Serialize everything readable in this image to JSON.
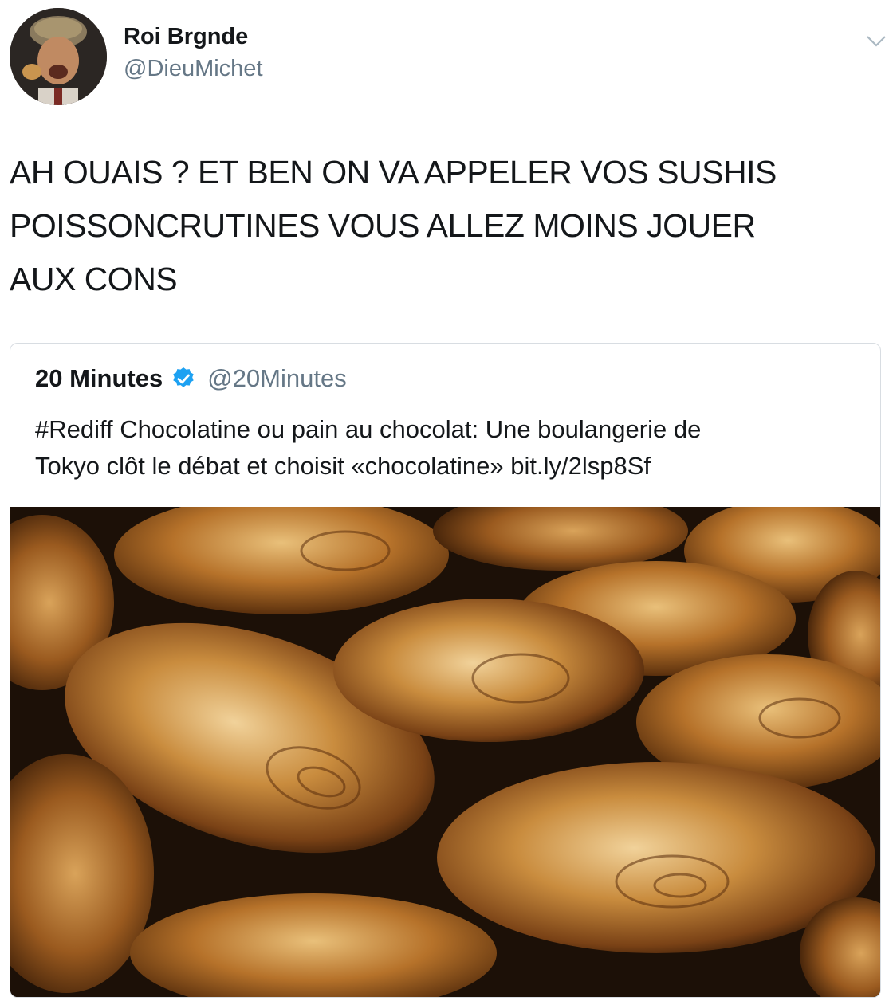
{
  "author": {
    "display_name": "Roi Brgnde",
    "handle": "@DieuMichet",
    "avatar_icon": "profile-photo"
  },
  "menu": {
    "icon": "chevron-down-icon"
  },
  "tweet": {
    "lines": [
      "AH OUAIS ? ET BEN ON VA APPELER VOS SUSHIS",
      "POISSONCRUTINES VOUS ALLEZ MOINS JOUER",
      "AUX CONS"
    ]
  },
  "quoted_tweet": {
    "display_name": "20 Minutes",
    "verified_icon": "verified-badge-icon",
    "handle": "@20Minutes",
    "lines": [
      "#Rediff Chocolatine ou pain au chocolat: Une boulangerie de",
      "Tokyo clôt le débat et choisit «chocolatine» bit.ly/2lsp8Sf"
    ],
    "image_subject": "pastries-photo"
  },
  "colors": {
    "text": "#14171a",
    "secondary": "#657786",
    "verified_blue": "#1da1f2",
    "border": "#d8dde2"
  }
}
